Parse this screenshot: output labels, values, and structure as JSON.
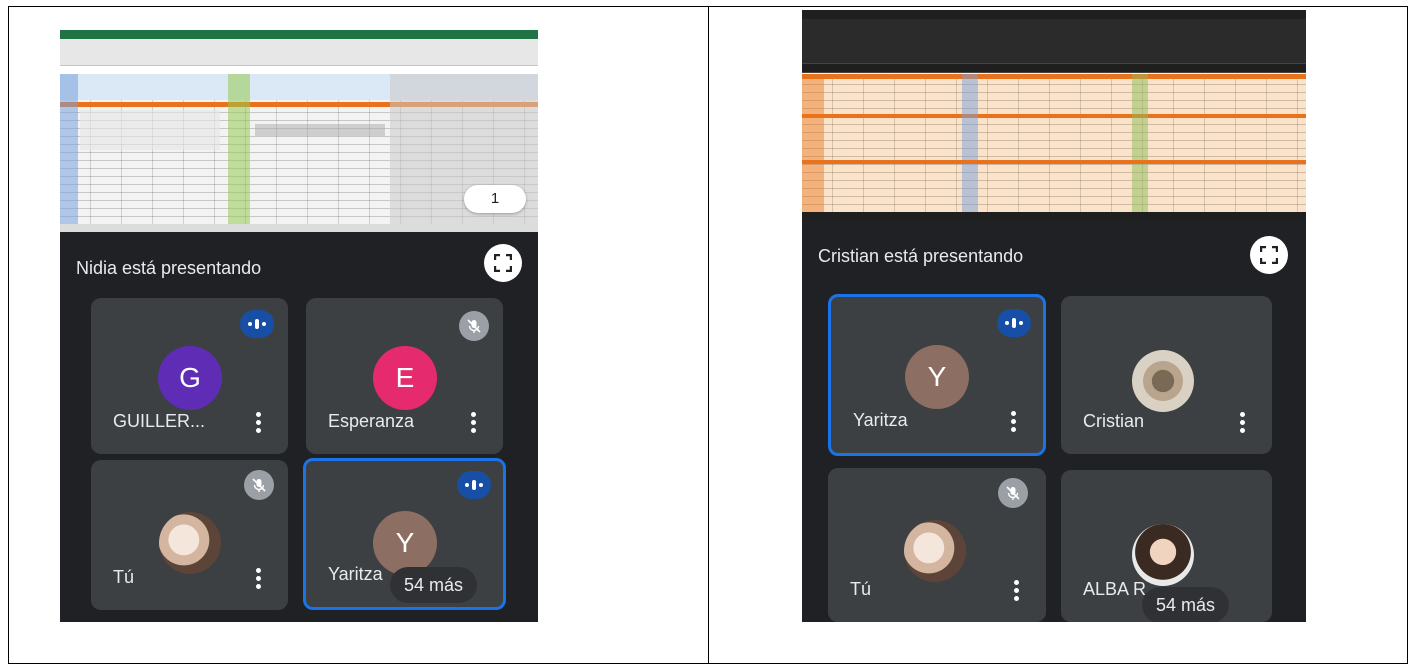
{
  "left_meeting": {
    "presenter_text": "Nidia está presentando",
    "page_indicator": "1",
    "participants": [
      {
        "name": "GUILLER...",
        "initial": "G",
        "avatar_color": "#5f2db5",
        "status": "speaking"
      },
      {
        "name": "Esperanza",
        "initial": "E",
        "avatar_color": "#e52b6d",
        "status": "muted"
      },
      {
        "name": "Tú",
        "initial": "",
        "avatar_color": "",
        "status": "muted"
      },
      {
        "name": "Yaritza",
        "initial": "Y",
        "avatar_color": "#8d6e63",
        "status": "speaking"
      }
    ],
    "more_label": "54 más"
  },
  "right_meeting": {
    "presenter_text": "Cristian está presentando",
    "participants": [
      {
        "name": "Yaritza",
        "initial": "Y",
        "avatar_color": "#8d6e63",
        "status": "speaking"
      },
      {
        "name": "Cristian",
        "initial": "",
        "avatar_color": "",
        "status": "none"
      },
      {
        "name": "Tú",
        "initial": "",
        "avatar_color": "",
        "status": "muted"
      },
      {
        "name": "ALBA R",
        "initial": "",
        "avatar_color": "",
        "status": "none"
      }
    ],
    "more_label": "54 más"
  },
  "colors": {
    "meet_background": "#202124",
    "tile_background": "#3c4043",
    "active_border": "#1a73e8",
    "excel_green": "#217346",
    "sheet_orange": "#e8731c"
  }
}
